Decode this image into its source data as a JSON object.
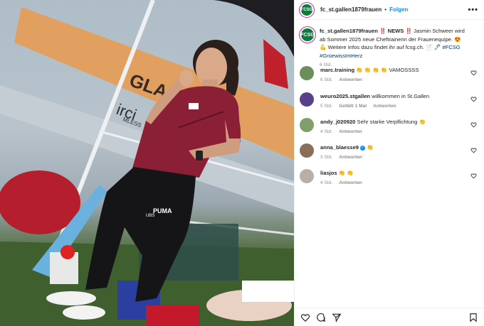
{
  "header": {
    "account": "fc_st.gallen1879frauen",
    "avatar_text": "FCSG",
    "separator": "•",
    "follow_label": "Folgen",
    "more_label": "•••"
  },
  "photo": {
    "banner_text_1": "GLAN",
    "banner_text_2": "irci",
    "banner_text_3": "MLESS",
    "shirt_brand": "UBS",
    "pants_brand": "PUMA"
  },
  "caption": {
    "account": "fc_st.gallen1879frauen",
    "news_label": "‼️ NEWS ‼️",
    "text": "Jasmin Schweer wird ab Sommer 2025 neue Cheftrainerin der Frauenequipe. 😍 💪 Weitere Infos dazu findet ihr auf fcsg.ch. 📄 🖊",
    "hashtag_1": "#FCSG",
    "hashtag_2": "#GrüewissImHerz",
    "time": "6 Std."
  },
  "comments": [
    {
      "user": "marc.training",
      "text": "👏 👏 👏 👏 VAMOSSSS",
      "time": "6 Std.",
      "likes": "",
      "reply": "Antworten",
      "avatar_color": "#6b8e5a",
      "verified": false
    },
    {
      "user": "weuro2025.stgallen",
      "text": "willkommen in St.Gallen",
      "time": "5 Std.",
      "likes": "Gefällt 1 Mal",
      "reply": "Antworten",
      "avatar_color": "#5a3f8c",
      "verified": false
    },
    {
      "user": "andy_j020920",
      "text": "Sehr starke Verpflichtung 👏",
      "time": "4 Std.",
      "likes": "",
      "reply": "Antworten",
      "avatar_color": "#7fa06a",
      "verified": false
    },
    {
      "user": "anna_blaesse9",
      "text": "👏",
      "time": "3 Std.",
      "likes": "",
      "reply": "Antworten",
      "avatar_color": "#8a6e5a",
      "verified": true
    },
    {
      "user": "liasjos",
      "text": "👏 👏",
      "time": "4 Std.",
      "likes": "",
      "reply": "Antworten",
      "avatar_color": "#b8b0a6",
      "verified": false
    }
  ],
  "actions": {
    "like": "heart-icon",
    "comment": "comment-icon",
    "share": "share-icon",
    "save": "bookmark-icon"
  },
  "colors": {
    "follow": "#0095f6",
    "brand": "#0b7a3b",
    "jersey": "#8a1f36"
  }
}
